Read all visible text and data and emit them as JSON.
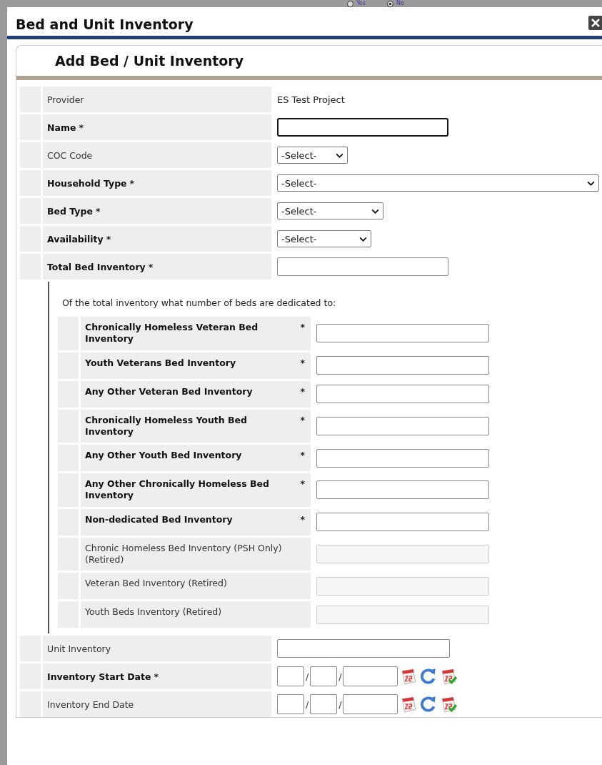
{
  "background": {
    "radio_options": [
      {
        "label": "Yes",
        "selected": false
      },
      {
        "label": "No",
        "selected": true
      }
    ]
  },
  "dialog": {
    "title": "Bed and Unit Inventory",
    "panel_title": "Add Bed / Unit Inventory",
    "fields_top": [
      {
        "label": "Provider",
        "kind": "static",
        "value": "ES Test Project"
      },
      {
        "label": "Name",
        "required_mark": "*",
        "kind": "text",
        "focused": true
      },
      {
        "label": "COC Code",
        "kind": "select",
        "value": "-Select-"
      },
      {
        "label": "Household Type",
        "required_mark": "*",
        "kind": "select",
        "value": "-Select-"
      },
      {
        "label": "Bed Type",
        "required_mark": "*",
        "kind": "select",
        "value": "-Select-"
      },
      {
        "label": "Availability",
        "required_mark": "*",
        "kind": "select",
        "value": "-Select-"
      },
      {
        "label": "Total Bed Inventory",
        "required_mark": "*",
        "kind": "text"
      }
    ],
    "dedicated": {
      "intro": "Of the total inventory what number of beds are dedicated to:",
      "fields": [
        {
          "label": "Chronically Homeless Veteran Bed Inventory",
          "required_mark": "*",
          "kind": "text"
        },
        {
          "label": "Youth Veterans Bed Inventory",
          "required_mark": "*",
          "kind": "text"
        },
        {
          "label": "Any Other Veteran Bed Inventory",
          "required_mark": "*",
          "kind": "text"
        },
        {
          "label": "Chronically Homeless Youth Bed Inventory",
          "required_mark": "*",
          "kind": "text"
        },
        {
          "label": "Any Other Youth Bed Inventory",
          "required_mark": "*",
          "kind": "text"
        },
        {
          "label": "Any Other Chronically Homeless Bed Inventory",
          "required_mark": "*",
          "kind": "text"
        },
        {
          "label": "Non-dedicated Bed Inventory",
          "required_mark": "*",
          "kind": "text"
        },
        {
          "label": "Chronic Homeless Bed Inventory (PSH Only) (Retired)",
          "kind": "readonly"
        },
        {
          "label": "Veteran Bed Inventory (Retired)",
          "kind": "readonly"
        },
        {
          "label": "Youth Beds Inventory (Retired)",
          "kind": "readonly"
        }
      ]
    },
    "fields_bottom": [
      {
        "label": "Unit Inventory",
        "kind": "text"
      },
      {
        "label": "Inventory Start Date",
        "required_mark": "*",
        "kind": "date",
        "separators": [
          "/",
          "/"
        ]
      },
      {
        "label": "Inventory End Date",
        "kind": "date",
        "separators": [
          "/",
          "/"
        ]
      }
    ]
  }
}
